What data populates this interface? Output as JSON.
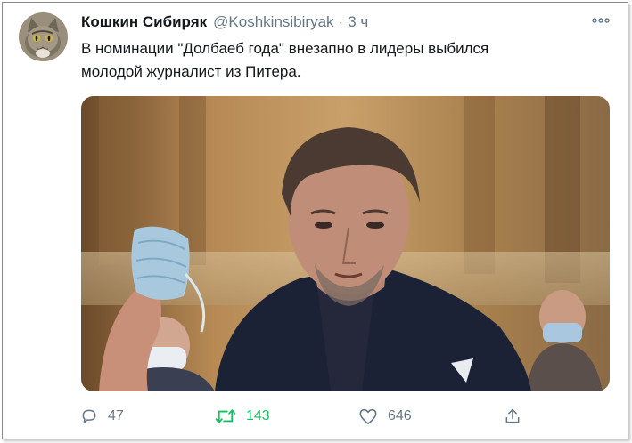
{
  "tweet": {
    "author_name": "Кошкин Сибиряк",
    "handle": "@Koshkinsibiryak",
    "separator": "·",
    "time": "3 ч",
    "text_lines": [
      "В номинации \"Долбаеб года\" внезапно в лидеры выбился",
      "молодой журналист из Питера."
    ]
  },
  "media": {
    "kind": "photo",
    "description_icon": "photo-image"
  },
  "actions": {
    "reply_count": "47",
    "retweet_count": "143",
    "like_count": "646"
  },
  "icons": {
    "more": "more-horizontal-icon",
    "reply": "reply-bubble-icon",
    "retweet": "retweet-arrows-icon",
    "like": "heart-icon",
    "share": "share-upload-icon"
  },
  "colors": {
    "text": "#14171a",
    "muted": "#657786",
    "retweet_active": "#17bf63",
    "frame_border": "#8a8a8a"
  }
}
